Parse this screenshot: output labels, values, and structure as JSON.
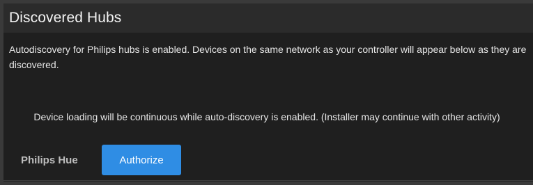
{
  "panel": {
    "title": "Discovered Hubs",
    "info": "Autodiscovery for Philips hubs is enabled. Devices on the same network as your controller will appear below as they are discovered.",
    "loading_note": "Device loading will be continuous while auto-discovery is enabled. (Installer may continue with other activity)"
  },
  "hubs": [
    {
      "name": "Philips Hue",
      "action_label": "Authorize"
    }
  ],
  "colors": {
    "panel_background": "#1f1f1f",
    "header_background": "#2b2b2b",
    "accent": "#2f8de4"
  }
}
